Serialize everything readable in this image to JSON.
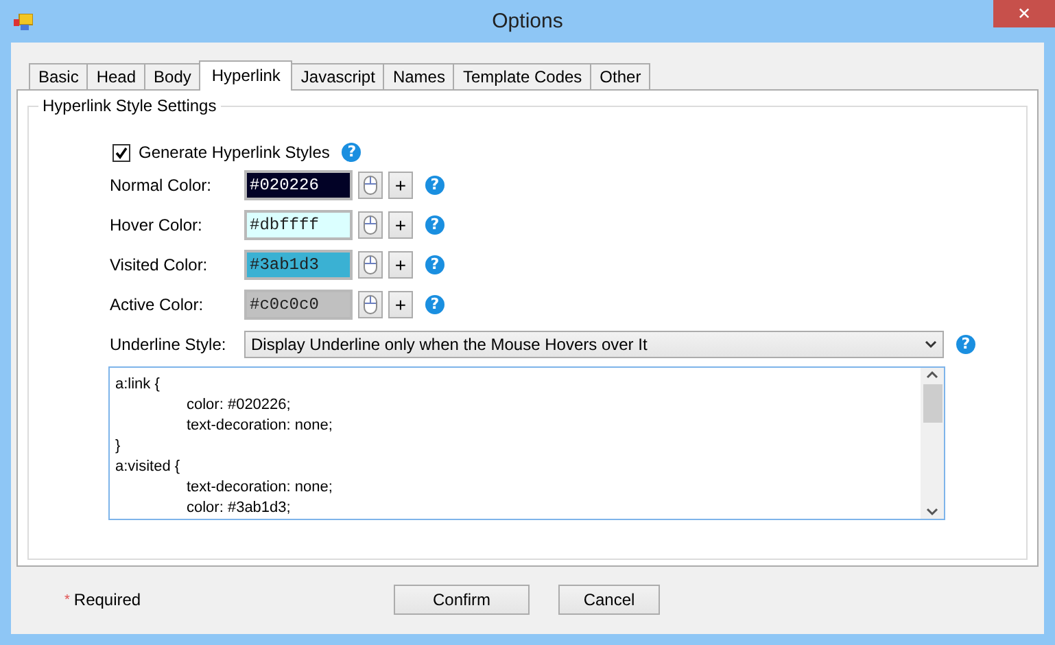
{
  "window": {
    "title": "Options",
    "close": "✕"
  },
  "tabs": [
    {
      "label": "Basic",
      "selected": false
    },
    {
      "label": "Head",
      "selected": false
    },
    {
      "label": "Body",
      "selected": false
    },
    {
      "label": "Hyperlink",
      "selected": true
    },
    {
      "label": "Javascript",
      "selected": false
    },
    {
      "label": "Names",
      "selected": false
    },
    {
      "label": "Template Codes",
      "selected": false
    },
    {
      "label": "Other",
      "selected": false
    }
  ],
  "group": {
    "title": "Hyperlink Style Settings"
  },
  "generate": {
    "label": "Generate Hyperlink Styles",
    "checked": true,
    "help": "?"
  },
  "color_rows": [
    {
      "label": "Normal Color:",
      "value": "#020226",
      "color": "#020226",
      "plus": "+",
      "help": "?"
    },
    {
      "label": "Hover Color:",
      "value": "#dbffff",
      "color": "#dbffff",
      "plus": "+",
      "help": "?"
    },
    {
      "label": "Visited Color:",
      "value": "#3ab1d3",
      "color": "#3ab1d3",
      "plus": "+",
      "help": "?"
    },
    {
      "label": "Active Color:",
      "value": "#c0c0c0",
      "color": "#c0c0c0",
      "plus": "+",
      "help": "?"
    }
  ],
  "underline": {
    "label": "Underline Style:",
    "value": "Display Underline only when the Mouse Hovers over It",
    "help": "?"
  },
  "css_lines": [
    {
      "text": "a:link {",
      "indented": false
    },
    {
      "text": "color: #020226;",
      "indented": true
    },
    {
      "text": "text-decoration: none;",
      "indented": true
    },
    {
      "text": "}",
      "indented": false
    },
    {
      "text": "a:visited {",
      "indented": false
    },
    {
      "text": "text-decoration: none;",
      "indented": true
    },
    {
      "text": "color: #3ab1d3;",
      "indented": true
    }
  ],
  "footer": {
    "required_mark": "*",
    "required": "Required",
    "buttons": [
      "Confirm",
      "Cancel"
    ]
  }
}
